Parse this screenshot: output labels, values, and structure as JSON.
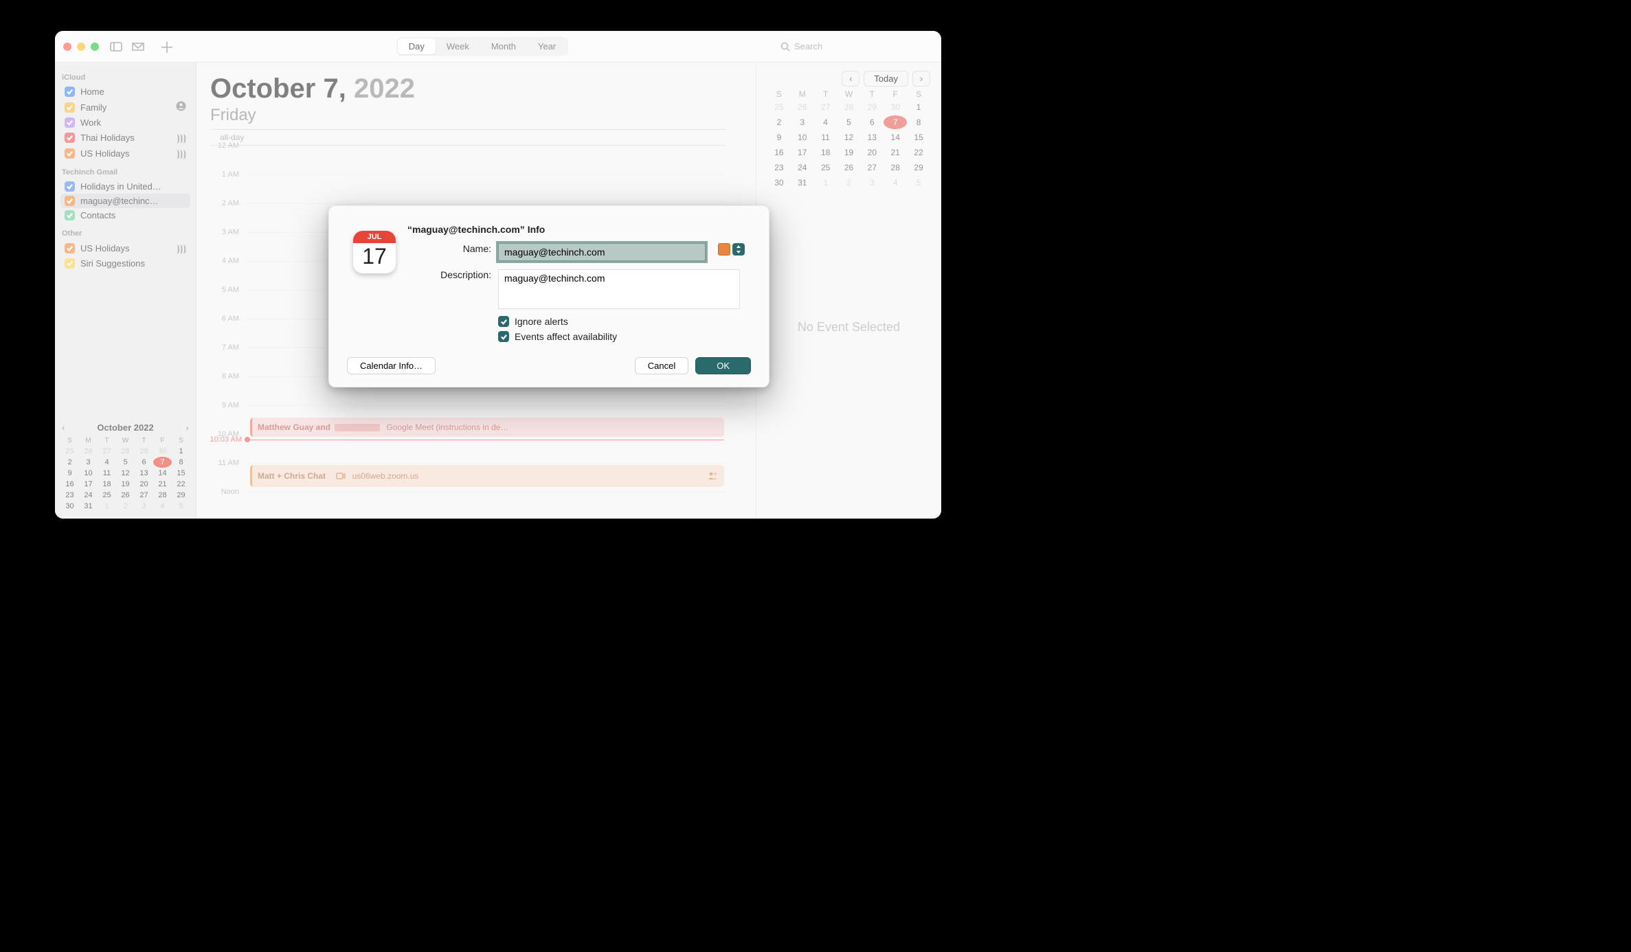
{
  "toolbar": {
    "views": {
      "day": "Day",
      "week": "Week",
      "month": "Month",
      "year": "Year"
    },
    "search_placeholder": "Search"
  },
  "sidebar": {
    "groups": [
      {
        "title": "iCloud",
        "items": [
          {
            "label": "Home",
            "color": "#4a8bf5"
          },
          {
            "label": "Family",
            "color": "#f3b84a",
            "shared": true
          },
          {
            "label": "Work",
            "color": "#b48af3"
          },
          {
            "label": "Thai Holidays",
            "color": "#e85b5b",
            "subscribed": true
          },
          {
            "label": "US Holidays",
            "color": "#ec8d44",
            "subscribed": true
          }
        ]
      },
      {
        "title": "Techinch Gmail",
        "items": [
          {
            "label": "Holidays in United…",
            "color": "#5c8ef0"
          },
          {
            "label": "maguay@techinc…",
            "color": "#ec8d44",
            "selected": true
          },
          {
            "label": "Contacts",
            "color": "#6fcf97"
          }
        ]
      },
      {
        "title": "Other",
        "items": [
          {
            "label": "US Holidays",
            "color": "#ec8d44",
            "subscribed": true
          },
          {
            "label": "Siri Suggestions",
            "color": "#f5cf52"
          }
        ]
      }
    ],
    "mini_cal": {
      "title": "October 2022",
      "dow": [
        "S",
        "M",
        "T",
        "W",
        "T",
        "F",
        "S"
      ],
      "rows": [
        [
          {
            "t": "25",
            "o": 1
          },
          {
            "t": "26",
            "o": 1
          },
          {
            "t": "27",
            "o": 1
          },
          {
            "t": "28",
            "o": 1
          },
          {
            "t": "29",
            "o": 1
          },
          {
            "t": "30",
            "o": 1
          },
          {
            "t": "1"
          }
        ],
        [
          {
            "t": "2"
          },
          {
            "t": "3"
          },
          {
            "t": "4"
          },
          {
            "t": "5"
          },
          {
            "t": "6"
          },
          {
            "t": "7",
            "today": 1
          },
          {
            "t": "8"
          }
        ],
        [
          {
            "t": "9"
          },
          {
            "t": "10"
          },
          {
            "t": "11"
          },
          {
            "t": "12"
          },
          {
            "t": "13"
          },
          {
            "t": "14"
          },
          {
            "t": "15"
          }
        ],
        [
          {
            "t": "16"
          },
          {
            "t": "17"
          },
          {
            "t": "18"
          },
          {
            "t": "19"
          },
          {
            "t": "20"
          },
          {
            "t": "21"
          },
          {
            "t": "22"
          }
        ],
        [
          {
            "t": "23"
          },
          {
            "t": "24"
          },
          {
            "t": "25"
          },
          {
            "t": "26"
          },
          {
            "t": "27"
          },
          {
            "t": "28"
          },
          {
            "t": "29"
          }
        ],
        [
          {
            "t": "30"
          },
          {
            "t": "31"
          },
          {
            "t": "1",
            "o": 1
          },
          {
            "t": "2",
            "o": 1
          },
          {
            "t": "3",
            "o": 1
          },
          {
            "t": "4",
            "o": 1
          },
          {
            "t": "5",
            "o": 1
          }
        ]
      ]
    }
  },
  "day_view": {
    "date_strong": "October 7,",
    "date_year": "2022",
    "weekday": "Friday",
    "allday_label": "all-day",
    "hours": [
      "12 AM",
      "1 AM",
      "2 AM",
      "3 AM",
      "4 AM",
      "5 AM",
      "6 AM",
      "7 AM",
      "8 AM",
      "9 AM",
      "10 AM",
      "11 AM",
      "Noon"
    ],
    "now_label": "10:03 AM",
    "events": [
      {
        "title_a": "Matthew Guay and",
        "title_b": "Google Meet (instructions in de…"
      },
      {
        "title": "Matt + Chris Chat",
        "link": "us06web.zoom.us"
      }
    ]
  },
  "right_pane": {
    "today": "Today",
    "dow": [
      "S",
      "M",
      "T",
      "W",
      "T",
      "F",
      "S"
    ],
    "rows": [
      [
        {
          "t": "25",
          "o": 1
        },
        {
          "t": "26",
          "o": 1
        },
        {
          "t": "27",
          "o": 1
        },
        {
          "t": "28",
          "o": 1
        },
        {
          "t": "29",
          "o": 1
        },
        {
          "t": "30",
          "o": 1
        },
        {
          "t": "1"
        }
      ],
      [
        {
          "t": "2"
        },
        {
          "t": "3"
        },
        {
          "t": "4"
        },
        {
          "t": "5"
        },
        {
          "t": "6"
        },
        {
          "t": "7",
          "today": 1
        },
        {
          "t": "8"
        }
      ],
      [
        {
          "t": "9"
        },
        {
          "t": "10"
        },
        {
          "t": "11"
        },
        {
          "t": "12"
        },
        {
          "t": "13"
        },
        {
          "t": "14"
        },
        {
          "t": "15"
        }
      ],
      [
        {
          "t": "16"
        },
        {
          "t": "17"
        },
        {
          "t": "18"
        },
        {
          "t": "19"
        },
        {
          "t": "20"
        },
        {
          "t": "21"
        },
        {
          "t": "22"
        }
      ],
      [
        {
          "t": "23"
        },
        {
          "t": "24"
        },
        {
          "t": "25"
        },
        {
          "t": "26"
        },
        {
          "t": "27"
        },
        {
          "t": "28"
        },
        {
          "t": "29"
        }
      ],
      [
        {
          "t": "30"
        },
        {
          "t": "31"
        },
        {
          "t": "1",
          "o": 1
        },
        {
          "t": "2",
          "o": 1
        },
        {
          "t": "3",
          "o": 1
        },
        {
          "t": "4",
          "o": 1
        },
        {
          "t": "5",
          "o": 1
        }
      ]
    ],
    "no_event": "No Event Selected"
  },
  "dialog": {
    "icon_month": "JUL",
    "icon_day": "17",
    "title": "“maguay@techinch.com” Info",
    "name_label": "Name:",
    "name_value": "maguay@techinch.com",
    "desc_label": "Description:",
    "desc_value": "maguay@techinch.com",
    "chk_ignore": "Ignore alerts",
    "chk_avail": "Events affect availability",
    "calendar_info": "Calendar Info…",
    "cancel": "Cancel",
    "ok": "OK"
  }
}
